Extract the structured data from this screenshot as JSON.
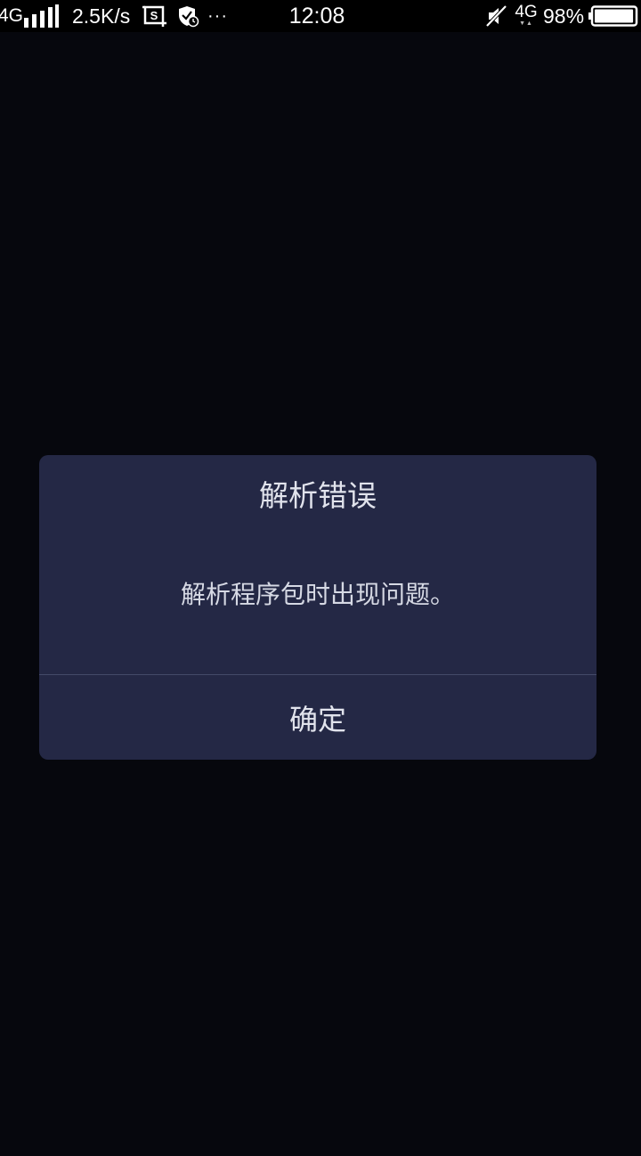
{
  "status_bar": {
    "network_left": "4G",
    "speed": "2.5K/s",
    "more": "···",
    "time": "12:08",
    "network_right": "4G",
    "network_arrows": "▼▲",
    "battery_percent": "98%",
    "battery_level": 0.98
  },
  "dialog": {
    "title": "解析错误",
    "message": "解析程序包时出现问题。",
    "confirm_label": "确定"
  },
  "colors": {
    "background": "#06070d",
    "dialog": "#242845",
    "text": "#e1e3ec"
  }
}
